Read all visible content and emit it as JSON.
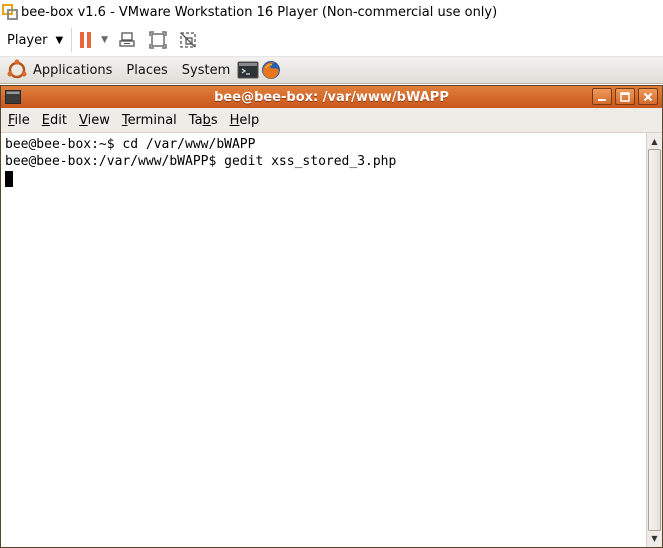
{
  "host": {
    "title": "bee-box v1.6 - VMware Workstation 16 Player (Non-commercial use only)",
    "toolbar": {
      "player_label": "Player",
      "icons": [
        "pause-icon",
        "send-ctrl-alt-del-icon",
        "fullscreen-icon",
        "unity-icon"
      ]
    },
    "accent_color": "#e8663c"
  },
  "panel": {
    "menus": [
      "Applications",
      "Places",
      "System"
    ],
    "launchers": [
      "terminal-launcher-icon",
      "firefox-launcher-icon"
    ]
  },
  "terminal": {
    "title": "bee@bee-box: /var/www/bWAPP",
    "menus": [
      {
        "label": "File",
        "mnemonic": "F"
      },
      {
        "label": "Edit",
        "mnemonic": "E"
      },
      {
        "label": "View",
        "mnemonic": "V"
      },
      {
        "label": "Terminal",
        "mnemonic": "T"
      },
      {
        "label": "Tabs",
        "mnemonic": "b"
      },
      {
        "label": "Help",
        "mnemonic": "H"
      }
    ],
    "lines": [
      "bee@bee-box:~$ cd /var/www/bWAPP",
      "bee@bee-box:/var/www/bWAPP$ gedit xss_stored_3.php"
    ],
    "titlebar_color": "#d8692a"
  }
}
